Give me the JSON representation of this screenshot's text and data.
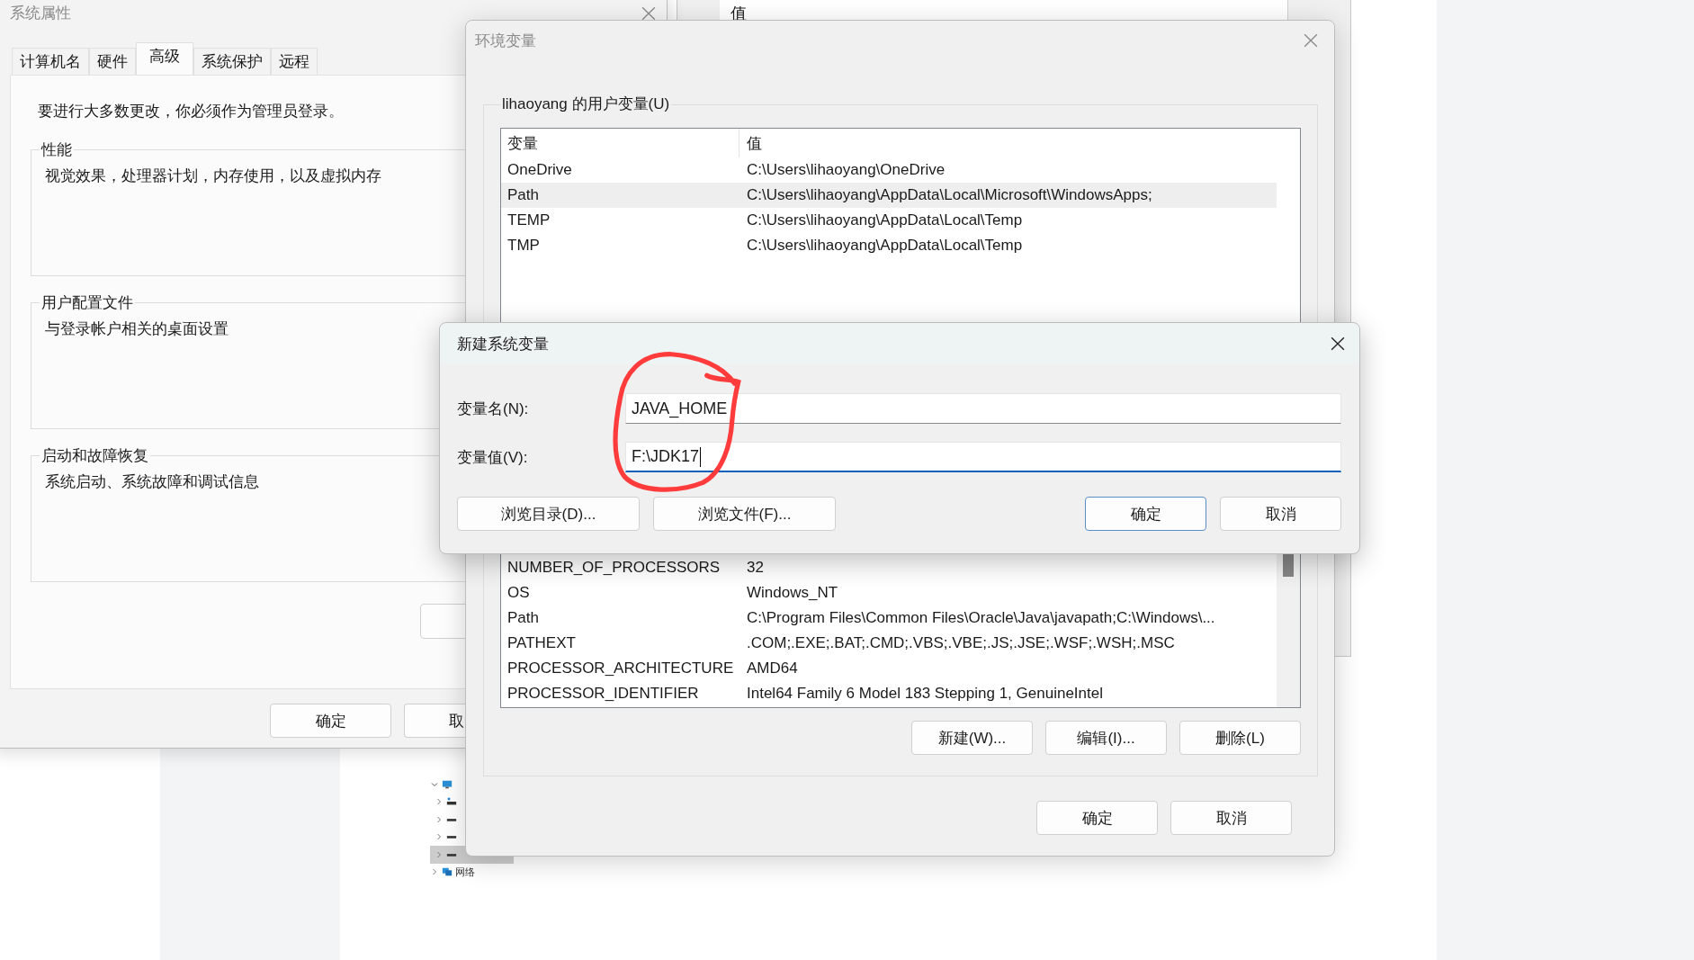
{
  "background_window": {
    "column_header": "值"
  },
  "system_properties": {
    "title": "系统属性",
    "tabs": [
      {
        "label": "计算机名",
        "selected": false
      },
      {
        "label": "硬件",
        "selected": false
      },
      {
        "label": "高级",
        "selected": true
      },
      {
        "label": "系统保护",
        "selected": false
      },
      {
        "label": "远程",
        "selected": false
      }
    ],
    "notice": "要进行大多数更改，你必须作为管理员登录。",
    "groups": [
      {
        "title": "性能",
        "description": "视觉效果，处理器计划，内存使用，以及虚拟内存"
      },
      {
        "title": "用户配置文件",
        "description": "与登录帐户相关的桌面设置"
      },
      {
        "title": "启动和故障恢复",
        "description": "系统启动、系统故障和调试信息"
      }
    ],
    "buttons": [
      "确定",
      "取"
    ]
  },
  "explorer": {
    "tree": [
      {
        "kind": "computer",
        "expanded": true,
        "children": [
          {
            "kind": "system_drive",
            "selected": false
          },
          {
            "kind": "drive",
            "selected": false
          },
          {
            "kind": "drive",
            "selected": false
          },
          {
            "kind": "drive",
            "selected": true
          }
        ]
      },
      {
        "kind": "network",
        "label": "网络",
        "expanded": false
      }
    ]
  },
  "environment_variables": {
    "title": "环境变量",
    "user_variables": {
      "title": "lihaoyang 的用户变量(U)",
      "columns": [
        "变量",
        "值"
      ],
      "rows": [
        {
          "name": "OneDrive",
          "value": "C:\\Users\\lihaoyang\\OneDrive",
          "selected": false
        },
        {
          "name": "Path",
          "value": "C:\\Users\\lihaoyang\\AppData\\Local\\Microsoft\\WindowsApps;",
          "selected": true
        },
        {
          "name": "TEMP",
          "value": "C:\\Users\\lihaoyang\\AppData\\Local\\Temp",
          "selected": false
        },
        {
          "name": "TMP",
          "value": "C:\\Users\\lihaoyang\\AppData\\Local\\Temp",
          "selected": false
        }
      ]
    },
    "system_variables": {
      "rows": [
        {
          "name": "NUMBER_OF_PROCESSORS",
          "value": "32",
          "selected": false
        },
        {
          "name": "OS",
          "value": "Windows_NT",
          "selected": false
        },
        {
          "name": "Path",
          "value": "C:\\Program Files\\Common Files\\Oracle\\Java\\javapath;C:\\Windows\\...",
          "selected": false
        },
        {
          "name": "PATHEXT",
          "value": ".COM;.EXE;.BAT;.CMD;.VBS;.VBE;.JS;.JSE;.WSF;.WSH;.MSC",
          "selected": false
        },
        {
          "name": "PROCESSOR_ARCHITECTURE",
          "value": "AMD64",
          "selected": false
        },
        {
          "name": "PROCESSOR_IDENTIFIER",
          "value": "Intel64 Family 6 Model 183 Stepping 1, GenuineIntel",
          "selected": false
        }
      ],
      "buttons": [
        "新建(W)...",
        "编辑(I)...",
        "删除(L)"
      ]
    },
    "buttons": [
      "确定",
      "取消"
    ]
  },
  "new_variable_dialog": {
    "title": "新建系统变量",
    "fields": [
      {
        "label": "变量名(N):",
        "value": "JAVA_HOME",
        "focused": false
      },
      {
        "label": "变量值(V):",
        "value": "F:\\JDK17",
        "focused": true
      }
    ],
    "buttons": [
      {
        "label": "浏览目录(D)...",
        "kind": "browse",
        "default": false
      },
      {
        "label": "浏览文件(F)...",
        "kind": "browse",
        "default": false
      },
      {
        "label": "确定",
        "kind": "action",
        "default": true
      },
      {
        "label": "取消",
        "kind": "action",
        "default": false
      }
    ]
  }
}
